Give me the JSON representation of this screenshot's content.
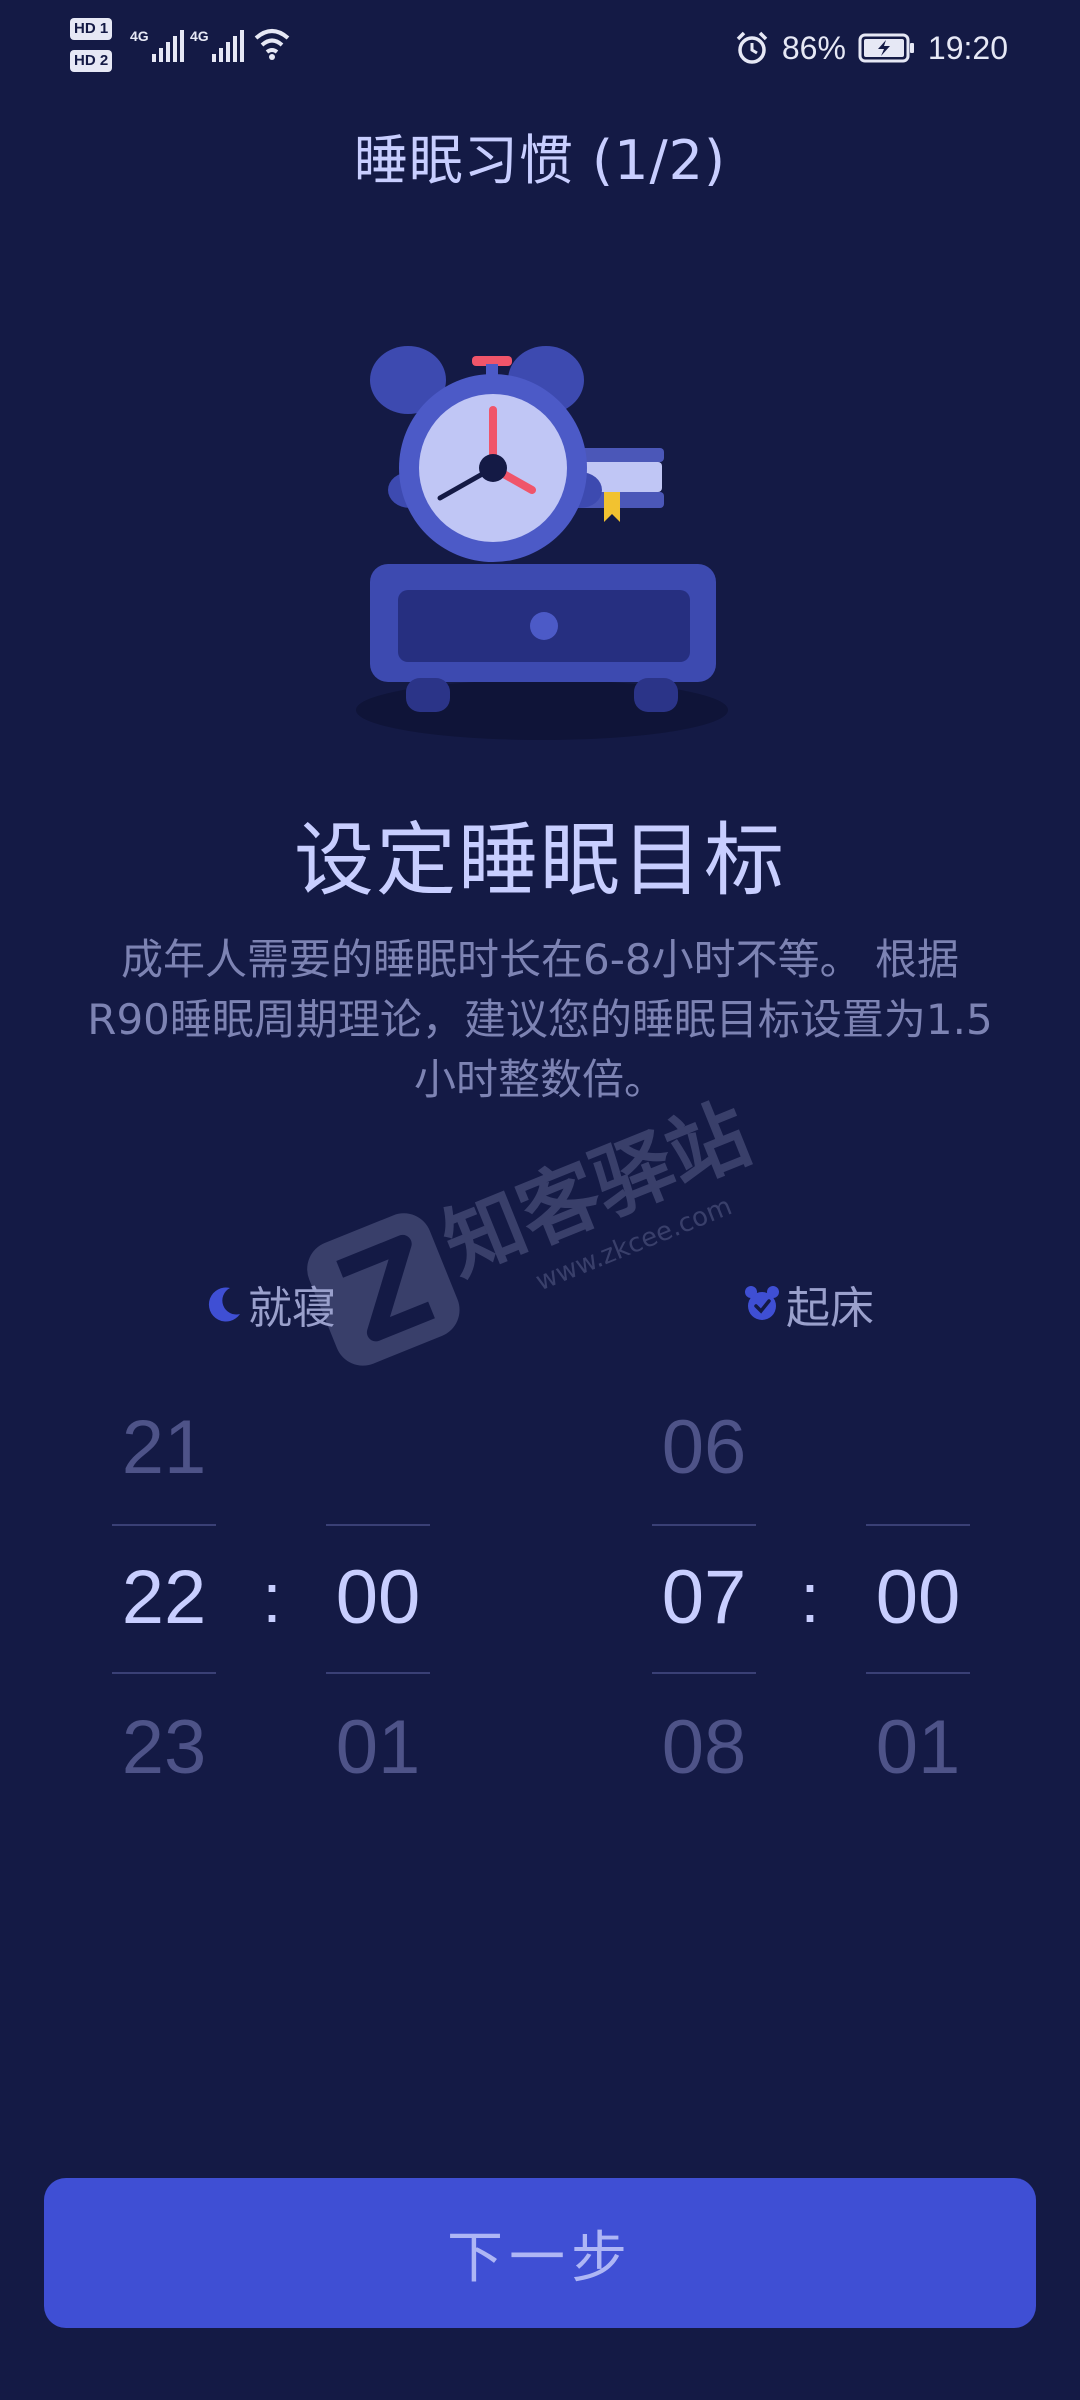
{
  "status_bar": {
    "sim1": "HD 1",
    "sim2": "HD 2",
    "net1": "4G",
    "net2": "4G",
    "battery_percent": "86%",
    "time": "19:20",
    "icons": [
      "wifi-icon",
      "alarm-icon",
      "battery-charging-icon",
      "signal-icon"
    ]
  },
  "header": {
    "title": "睡眠习惯 (1/2)"
  },
  "content": {
    "headline": "设定睡眠目标",
    "description": "成年人需要的睡眠时长在6-8小时不等。 根据R90睡眠周期理论，建议您的睡眠目标设置为1.5小时整数倍。"
  },
  "watermark": {
    "text": "知客驿站",
    "url": "www.zkcee.com"
  },
  "bedtime": {
    "label": "就寝",
    "icon": "moon-icon",
    "hour": {
      "prev": "21",
      "current": "22",
      "next": "23"
    },
    "minute": {
      "prev": "",
      "current": "00",
      "next": "01"
    },
    "separator": ":"
  },
  "wake": {
    "label": "起床",
    "icon": "alarm-clock-icon",
    "hour": {
      "prev": "06",
      "current": "07",
      "next": "08"
    },
    "minute": {
      "prev": "",
      "current": "00",
      "next": "01"
    },
    "separator": ":"
  },
  "footer": {
    "next_label": "下一步"
  },
  "colors": {
    "background": "#141a45",
    "accent": "#3f4fd4",
    "text_primary": "#c8ceff",
    "text_muted": "#7d83b3"
  }
}
